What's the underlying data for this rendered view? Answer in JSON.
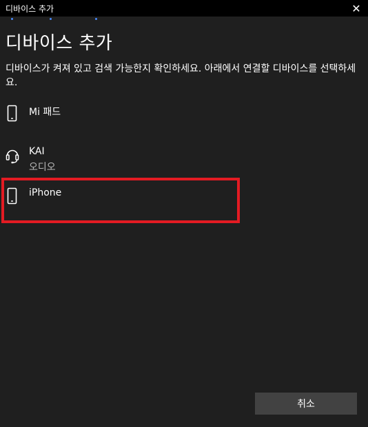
{
  "window": {
    "title": "디바이스 추가",
    "close_glyph": "✕"
  },
  "page": {
    "heading": "디바이스 추가",
    "description": "디바이스가 켜져 있고 검색 가능한지 확인하세요. 아래에서 연결할 디바이스를 선택하세요."
  },
  "devices": [
    {
      "name": "Mi 패드",
      "subtitle": "",
      "icon": "phone-icon"
    },
    {
      "name": "KAI",
      "subtitle": "오디오",
      "icon": "headset-icon"
    },
    {
      "name": "iPhone",
      "subtitle": "",
      "icon": "phone-icon"
    }
  ],
  "buttons": {
    "cancel_label": "취소"
  },
  "colors": {
    "background": "#1f1f1f",
    "titlebar": "#000000",
    "highlight": "#e31b23",
    "progress_dots": "#4a8cff",
    "button": "#424242"
  }
}
